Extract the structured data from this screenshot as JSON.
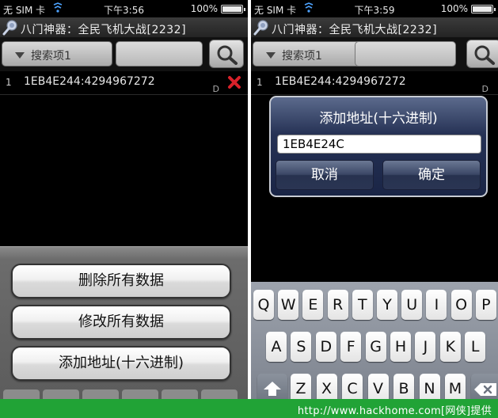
{
  "left": {
    "status": {
      "carrier": "无 SIM 卡",
      "time": "下午3:56",
      "battery": "100%"
    },
    "title": "八门神器：全民飞机大战[2232]",
    "search_dropdown_label": "搜索项1",
    "row": {
      "index": "1",
      "entry": "1EB4E244:4294967272",
      "type": "D"
    },
    "sheet_buttons": [
      "删除所有数据",
      "修改所有数据",
      "添加地址(十六进制)"
    ]
  },
  "right": {
    "status": {
      "carrier": "无 SIM 卡",
      "time": "下午3:59",
      "battery": "100%"
    },
    "title": "八门神器：全民飞机大战[2232]",
    "search_dropdown_label": "搜索项1",
    "row": {
      "index": "1",
      "entry": "1EB4E244:4294967272",
      "type": "D"
    },
    "dialog": {
      "title": "添加地址(十六进制)",
      "input_value": "1EB4E24C",
      "cancel_label": "取消",
      "confirm_label": "确定"
    },
    "keyboard": {
      "row1": [
        "Q",
        "W",
        "E",
        "R",
        "T",
        "Y",
        "U",
        "I",
        "O",
        "P"
      ],
      "row2": [
        "A",
        "S",
        "D",
        "F",
        "G",
        "H",
        "J",
        "K",
        "L"
      ],
      "row3": [
        "Z",
        "X",
        "C",
        "V",
        "B",
        "N",
        "M"
      ]
    }
  },
  "watermark": "http://www.hackhome.com[网侠]提供",
  "colors": {
    "accent_delete": "#d8212a",
    "watermark_bg": "#21a336",
    "dialog_bg": "#253154"
  },
  "icons": [
    "wifi-icon",
    "battery-icon",
    "app-icon",
    "search-icon",
    "delete-icon",
    "dropdown-caret-icon",
    "shift-icon",
    "backspace-icon"
  ]
}
